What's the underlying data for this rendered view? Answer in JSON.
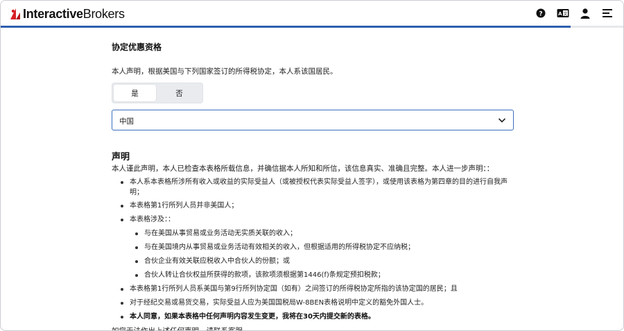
{
  "header": {
    "brand_bold": "Interactive",
    "brand_light": "Brokers",
    "icons": [
      "help-icon",
      "translate-icon",
      "account-icon",
      "menu-icon"
    ],
    "progress_fraction": 0.915,
    "accent": "#2f5fad",
    "logo_red": "#d81f26"
  },
  "treaty": {
    "title": "协定优惠资格",
    "intro": "本人声明，根据美国与下列国家签订的所得税协定，本人系该国居民。",
    "yes_label": "是",
    "no_label": "否",
    "selected": "是",
    "country_value": "中国"
  },
  "declaration": {
    "title": "声明",
    "intro": "本人谨此声明，本人已检查本表格所载信息，并确信据本人所知和所信，该信息真实、准确且完整。本人进一步声明：：",
    "items": [
      "本人系本表格所涉所有收入或收益的实际受益人（或被授权代表实际受益人签字），或使用该表格为第四章的目的进行自我声明；",
      "本表格第1行所列人员并非美国人；",
      "本表格涉及：：",
      "本表格第1行所列人员系美国与第9行所列协定国（如有）之间签订的所得税协定所指的该协定国的居民；且",
      "对于经纪交易或易货交易，实际受益人应为美国国税局W-8BEN表格说明中定义的豁免外国人士。",
      "本人同意，如果本表格中任何声明内容发生变更，我将在30天内提交新的表格。"
    ],
    "sub_items": [
      "与在美国从事贸易或业务活动无实质关联的收入；",
      "与在美国境内从事贸易或业务活动有效相关的收入，但根据适用的所得税协定不应纳税；",
      "合伙企业有效关联应税收入中合伙人的份额；或",
      "合伙人转让合伙权益所获得的款项，该款项须根据第1446(f)条规定预扣税款；"
    ],
    "footer": "如您无法作出上述任何声明，请联系客服。"
  }
}
